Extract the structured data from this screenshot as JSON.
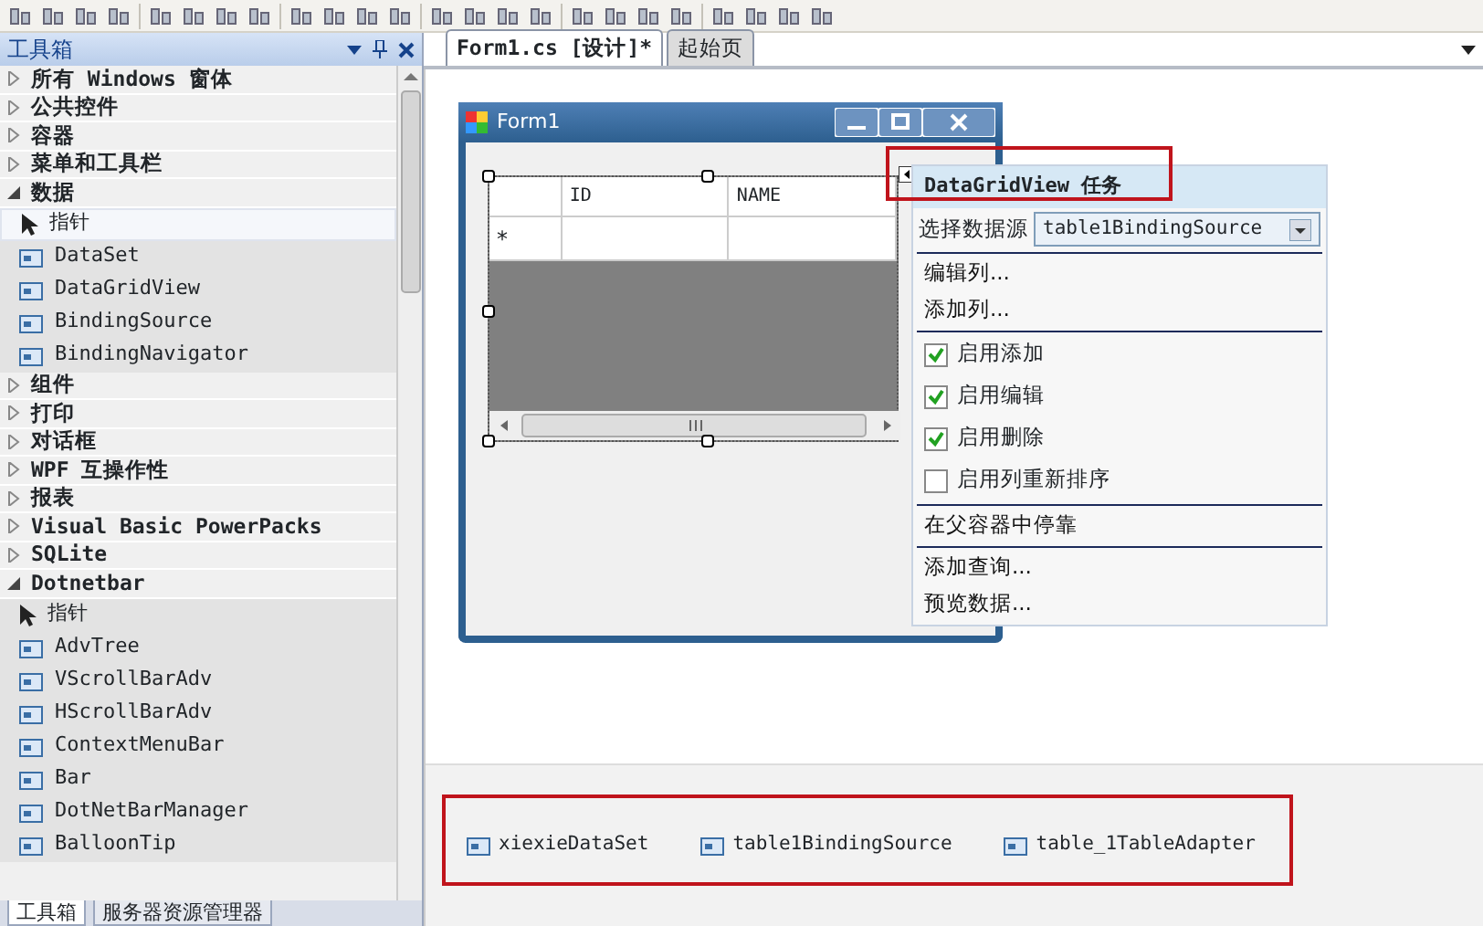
{
  "toolbox": {
    "title": "工具箱",
    "categories": [
      {
        "label": "所有 Windows 窗体",
        "expanded": false
      },
      {
        "label": "公共控件",
        "expanded": false
      },
      {
        "label": "容器",
        "expanded": false
      },
      {
        "label": "菜单和工具栏",
        "expanded": false
      },
      {
        "label": "数据",
        "expanded": true,
        "tools": [
          {
            "label": "指针",
            "selected": true
          },
          {
            "label": "DataSet",
            "selected": false
          },
          {
            "label": "DataGridView",
            "selected": false
          },
          {
            "label": "BindingSource",
            "selected": false
          },
          {
            "label": "BindingNavigator",
            "selected": false
          }
        ]
      },
      {
        "label": "组件",
        "expanded": false
      },
      {
        "label": "打印",
        "expanded": false
      },
      {
        "label": "对话框",
        "expanded": false
      },
      {
        "label": "WPF 互操作性",
        "expanded": false
      },
      {
        "label": "报表",
        "expanded": false
      },
      {
        "label": "Visual Basic PowerPacks",
        "expanded": false
      },
      {
        "label": "SQLite",
        "expanded": false
      },
      {
        "label": "Dotnetbar",
        "expanded": true,
        "tools": [
          {
            "label": "指针",
            "selected": false
          },
          {
            "label": "AdvTree",
            "selected": false
          },
          {
            "label": "VScrollBarAdv",
            "selected": false
          },
          {
            "label": "HScrollBarAdv",
            "selected": false
          },
          {
            "label": "ContextMenuBar",
            "selected": false
          },
          {
            "label": "Bar",
            "selected": false
          },
          {
            "label": "DotNetBarManager",
            "selected": false
          },
          {
            "label": "BalloonTip",
            "selected": false
          }
        ]
      }
    ]
  },
  "bottom_tabs": [
    {
      "label": "工具箱",
      "selected": true
    },
    {
      "label": "服务器资源管理器",
      "selected": false
    }
  ],
  "document_tabs": [
    {
      "label": "Form1.cs [设计]*",
      "selected": true
    },
    {
      "label": "起始页",
      "selected": false
    }
  ],
  "form": {
    "title": "Form1",
    "grid": {
      "columns": [
        "ID",
        "NAME"
      ],
      "new_row_marker": "*"
    }
  },
  "smart_tag": {
    "title": "DataGridView 任务",
    "data_source": {
      "label": "选择数据源",
      "value": "table1BindingSource"
    },
    "sections": [
      {
        "items": [
          {
            "kind": "link",
            "label": "编辑列..."
          },
          {
            "kind": "link",
            "label": "添加列..."
          }
        ]
      },
      {
        "items": [
          {
            "kind": "checkbox",
            "label": "启用添加",
            "checked": true
          },
          {
            "kind": "checkbox",
            "label": "启用编辑",
            "checked": true
          },
          {
            "kind": "checkbox",
            "label": "启用删除",
            "checked": true
          },
          {
            "kind": "checkbox",
            "label": "启用列重新排序",
            "checked": false
          }
        ]
      },
      {
        "items": [
          {
            "kind": "link",
            "label": "在父容器中停靠"
          }
        ]
      },
      {
        "items": [
          {
            "kind": "link",
            "label": "添加查询..."
          },
          {
            "kind": "link",
            "label": "预览数据..."
          }
        ]
      }
    ]
  },
  "component_tray": [
    {
      "label": "xiexieDataSet"
    },
    {
      "label": "table1BindingSource"
    },
    {
      "label": "table_1TableAdapter"
    }
  ]
}
